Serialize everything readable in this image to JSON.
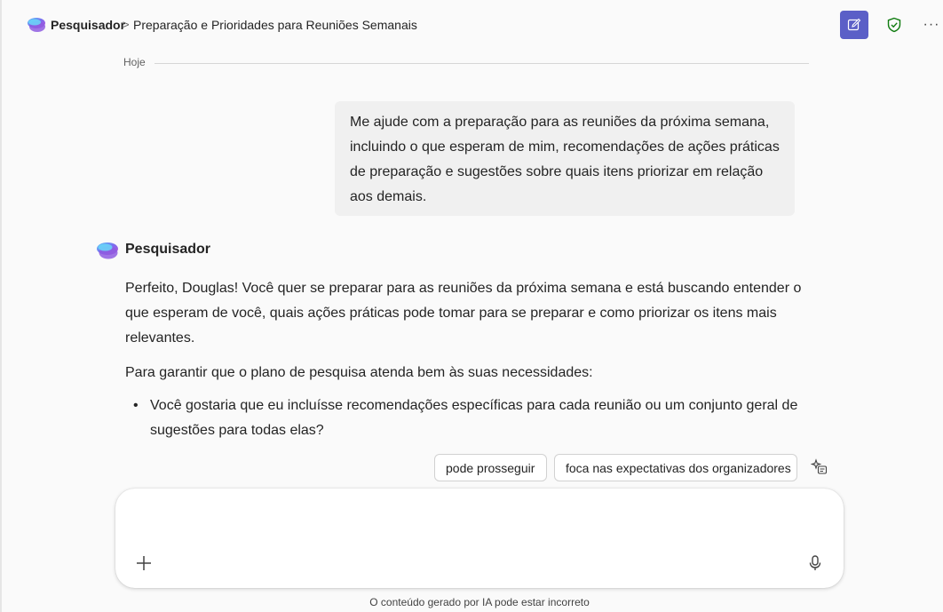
{
  "header": {
    "app_name": "Pesquisador",
    "separator": ">",
    "conversation_title": "Preparação e Prioridades para Reuniões Semanais",
    "more_label": "···"
  },
  "divider": {
    "label": "Hoje"
  },
  "user_message": {
    "text": "Me ajude com a preparação para as reuniões da próxima semana, incluindo o que esperam de mim, recomendações de ações práticas de preparação e sugestões sobre quais itens priorizar em relação aos demais."
  },
  "assistant": {
    "name": "Pesquisador",
    "paragraphs": [
      "Perfeito, Douglas! Você quer se preparar para as reuniões da próxima semana e está buscando entender o que esperam de você, quais ações práticas pode tomar para se preparar e como priorizar os itens mais relevantes.",
      "Para garantir que o plano de pesquisa atenda bem às suas necessidades:"
    ],
    "bullets": [
      "Você gostaria que eu incluísse recomendações específicas para cada reunião ou um conjunto geral de sugestões para todas elas?"
    ]
  },
  "suggestions": [
    "pode prosseguir",
    "foca nas expectativas dos organizadores"
  ],
  "composer": {
    "value": "",
    "placeholder": ""
  },
  "disclaimer": "O conteúdo gerado por IA pode estar incorreto",
  "icons": {
    "logo": "researcher-logo-icon",
    "new_chat": "new-chat-icon",
    "shield": "shield-check-icon",
    "more": "more-icon",
    "sparkle": "sparkle-icon",
    "add": "plus-icon",
    "mic": "microphone-icon"
  },
  "colors": {
    "accent": "#5b5fc7",
    "shield": "#107c10",
    "bubble": "#f0f0f0",
    "background": "#fafafa"
  }
}
